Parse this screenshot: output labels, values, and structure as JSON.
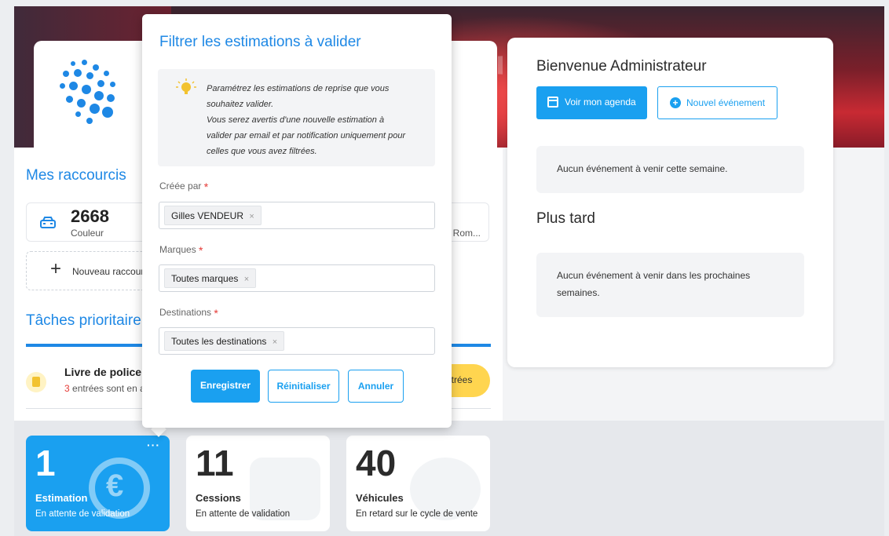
{
  "shortcuts": {
    "title": "Mes raccourcis",
    "item": {
      "value": "2668",
      "label": "Couleur",
      "right_label": "Rom..."
    },
    "new_label": "Nouveau raccour"
  },
  "tasks": {
    "title": "Tâches prioritaire",
    "item_title": "Livre de police",
    "item_count": "3",
    "item_sub": " entrées sont en a",
    "pill_label": "ntrées"
  },
  "stats": [
    {
      "value": "1",
      "label": "Estimation",
      "sub": "En attente de validation",
      "more": "···"
    },
    {
      "value": "11",
      "label": "Cessions",
      "sub": "En attente de validation"
    },
    {
      "value": "40",
      "label": "Véhicules",
      "sub": "En retard sur le cycle de vente"
    }
  ],
  "welcome": {
    "title": "Bienvenue Administrateur",
    "agenda_button": "Voir mon agenda",
    "event_button": "Nouvel événement",
    "week_empty": "Aucun événement à venir cette semaine.",
    "later_title": "Plus tard",
    "later_empty": "Aucun événement à venir dans les prochaines semaines."
  },
  "modal": {
    "title": "Filtrer les estimations à valider",
    "tip_lines": [
      "Paramétrez les estimations de reprise que vous",
      "souhaitez valider.",
      "Vous serez avertis d'une nouvelle estimation à",
      "valider par email et par notification uniquement pour",
      "celles que vous avez filtrées."
    ],
    "fields": {
      "created_by": {
        "label": "Créée par",
        "star": "*",
        "tag": "Gilles VENDEUR",
        "remove": "×"
      },
      "brands": {
        "label": "Marques",
        "star": "*",
        "tag": "Toutes marques",
        "remove": "×"
      },
      "destinations": {
        "label": "Destinations",
        "star": "*",
        "tag": "Toutes les destinations",
        "remove": "×"
      }
    },
    "buttons": {
      "save": "Enregistrer",
      "reset": "Réinitialiser",
      "cancel": "Annuler"
    }
  },
  "colors": {
    "accent": "#1aa0f0",
    "title_blue": "#1e88e5",
    "required": "#e53935",
    "warning": "#ffd54f"
  }
}
